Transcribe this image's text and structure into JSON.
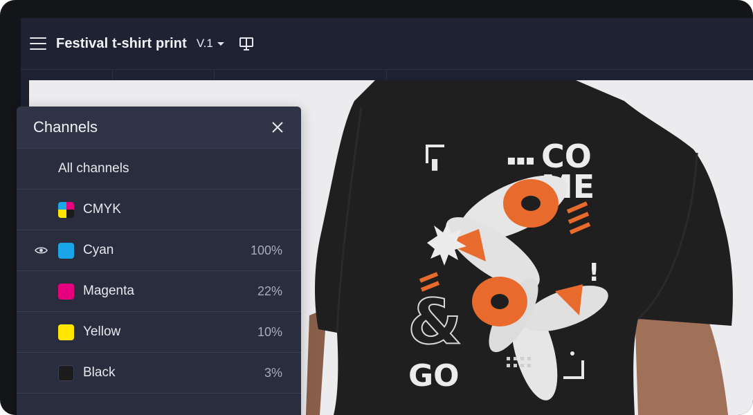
{
  "header": {
    "title": "Festival t-shirt print",
    "version": "V.1"
  },
  "icons": {
    "menu": "hamburger-menu-icon",
    "preview": "preview-monitor-icon",
    "close": "close-icon",
    "visibility": "eye-icon"
  },
  "artwork": {
    "line1": "CO",
    "line2": "ME",
    "ampersand": "&",
    "line3": "GO"
  },
  "channels_panel": {
    "title": "Channels",
    "rows": [
      {
        "label": "All channels",
        "percent": "",
        "visible": false,
        "color": ""
      },
      {
        "label": "CMYK",
        "percent": "",
        "visible": false,
        "color": "cmyk"
      },
      {
        "label": "Cyan",
        "percent": "100%",
        "visible": true,
        "color": "#1aa6e8"
      },
      {
        "label": "Magenta",
        "percent": "22%",
        "visible": false,
        "color": "#e6007e"
      },
      {
        "label": "Yellow",
        "percent": "10%",
        "visible": false,
        "color": "#ffe600"
      },
      {
        "label": "Black",
        "percent": "3%",
        "visible": false,
        "color": "#1c1c1c"
      }
    ]
  },
  "colors": {
    "accent_orange": "#e86a2c",
    "shirt": "#1e1e1f",
    "panel_bg": "#2a2d3d"
  }
}
